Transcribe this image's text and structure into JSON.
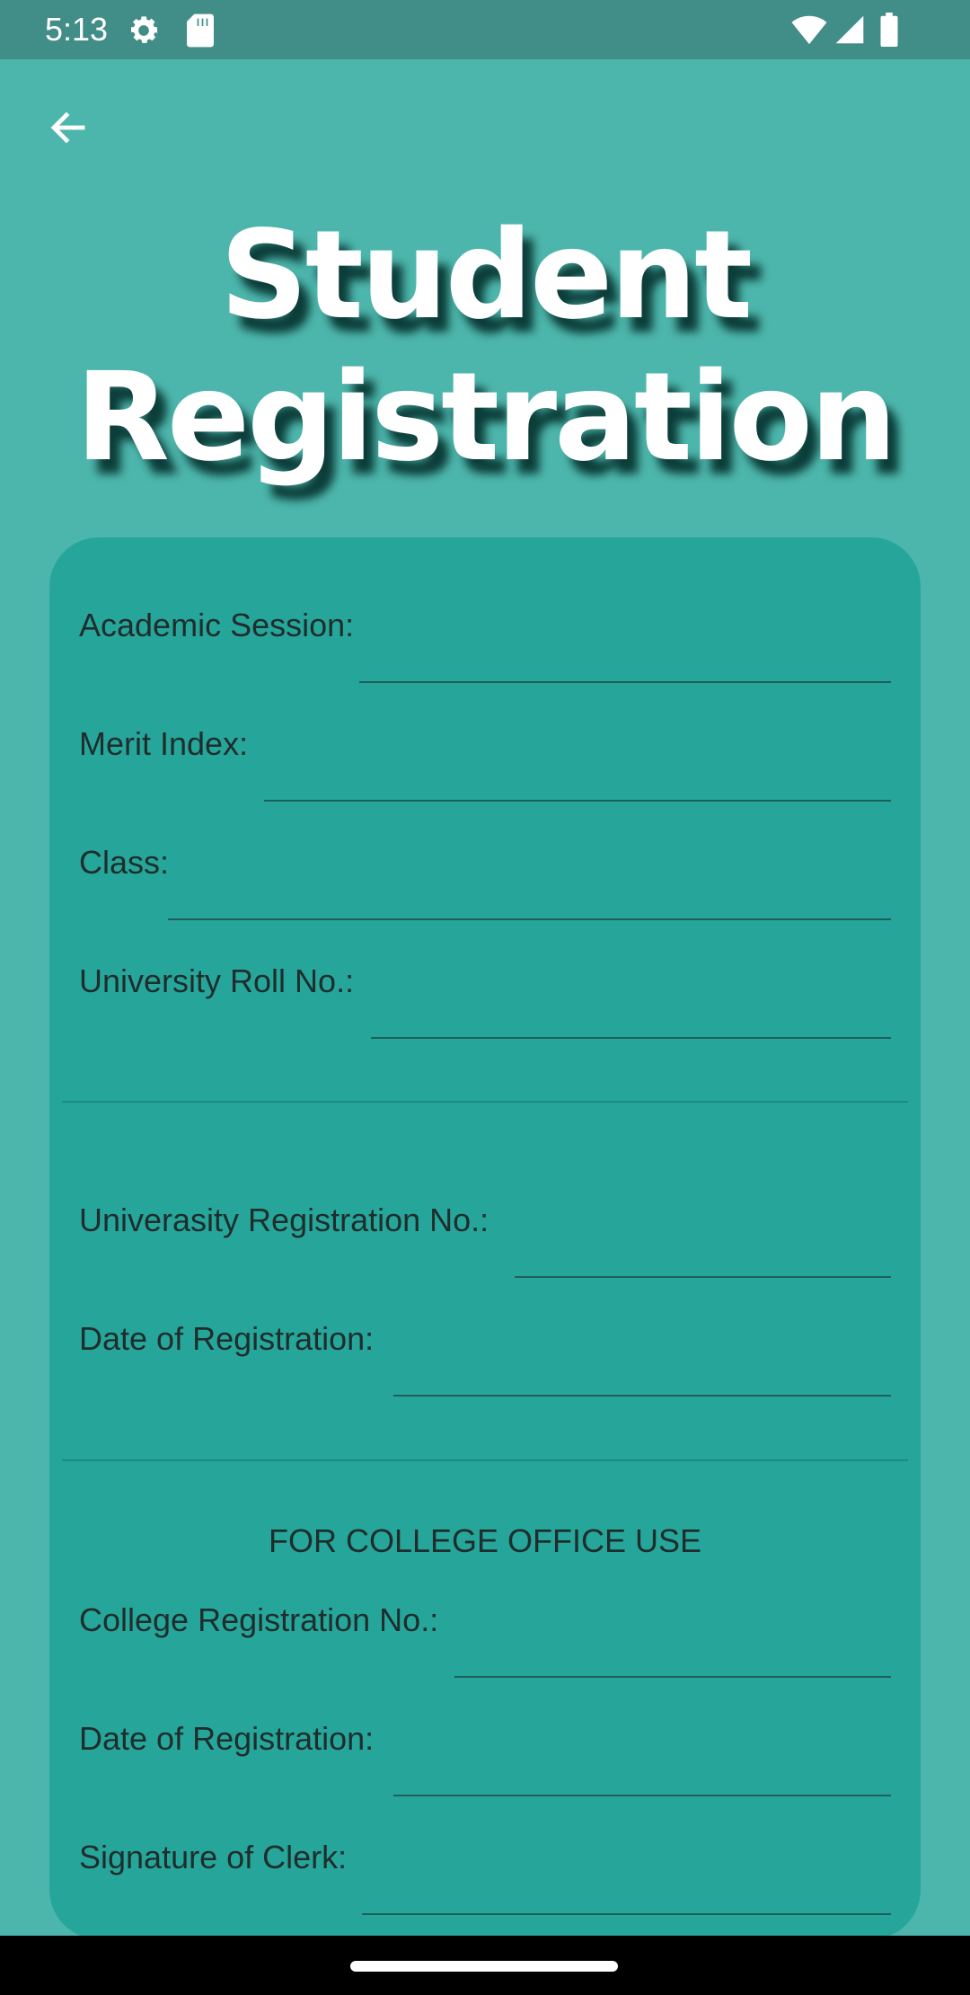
{
  "status_bar": {
    "time": "5:13",
    "icons": [
      "settings-icon",
      "sd-card-icon",
      "wifi-icon",
      "cell-signal-icon",
      "battery-icon"
    ]
  },
  "header": {
    "back_icon": "arrow-left-icon",
    "title_line1": "Student",
    "title_line2": "Registration"
  },
  "colors": {
    "background": "#4db6ac",
    "card": "#26a69a",
    "status_bar": "#418d87",
    "title": "#ffffff"
  },
  "form": {
    "academic_session": {
      "label": "Academic Session:",
      "value": ""
    },
    "merit_index": {
      "label": "Merit Index:",
      "value": ""
    },
    "class": {
      "label": "Class:",
      "value": ""
    },
    "university_roll_no": {
      "label": "University Roll No.:",
      "value": ""
    },
    "university_registration_no": {
      "label": "Univerasity Registration No.:",
      "value": ""
    },
    "date_of_registration": {
      "label": "Date of Registration:",
      "value": ""
    },
    "office_heading": "FOR COLLEGE OFFICE USE",
    "college_registration_no": {
      "label": "College Registration No.:",
      "value": ""
    },
    "office_date_of_registration": {
      "label": "Date of Registration:",
      "value": ""
    },
    "signature_of_clerk": {
      "label": "Signature of Clerk:",
      "value": ""
    }
  }
}
